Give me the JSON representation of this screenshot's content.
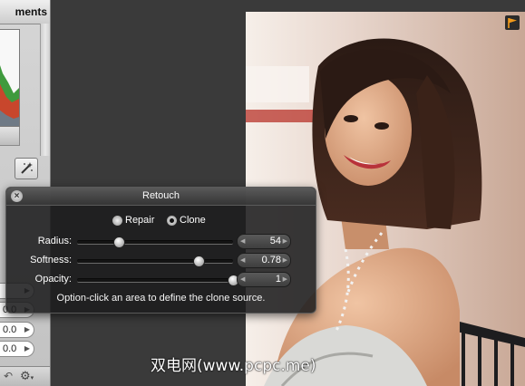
{
  "panel": {
    "tab_label": "ments",
    "field_values": [
      "",
      "0.0",
      "0.0",
      "0.0"
    ],
    "undo_icon": "undo-icon",
    "gear_icon": "gear-icon"
  },
  "retouch": {
    "title": "Retouch",
    "mode_options": [
      "Repair",
      "Clone"
    ],
    "selected_mode": "Clone",
    "sliders": [
      {
        "label": "Radius:",
        "value": "54",
        "fraction": 0.27
      },
      {
        "label": "Softness:",
        "value": "0.78",
        "fraction": 0.78
      },
      {
        "label": "Opacity:",
        "value": "1",
        "fraction": 1.0
      }
    ],
    "hint": "Option-click an area to define the clone source."
  },
  "watermark": "双电网(www.pcpc.me)",
  "colors": {
    "hud_background": "#1c1c1e",
    "canvas_background": "#3a3a3a",
    "flag_accent": "#f29a1a"
  }
}
